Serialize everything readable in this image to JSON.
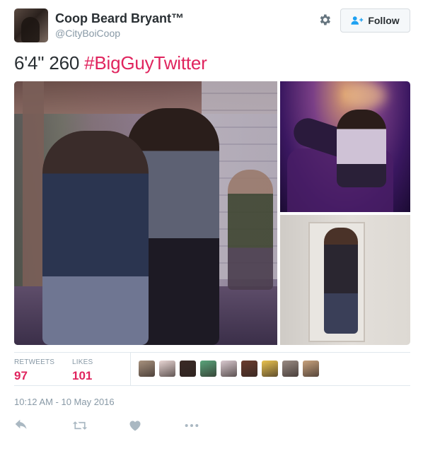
{
  "author": {
    "display_name": "Coop Beard Bryant™",
    "screen_name": "@CityBoiCoop"
  },
  "header": {
    "follow_label": "Follow"
  },
  "tweet": {
    "text": "6'4\" 260",
    "hashtag": "#BigGuyTwitter"
  },
  "stats": {
    "retweets_label": "RETWEETS",
    "retweets_count": "97",
    "likes_label": "LIKES",
    "likes_count": "101"
  },
  "likers": [
    {
      "color": "#a8927e"
    },
    {
      "color": "#e8d5d3"
    },
    {
      "color": "#3b2a25"
    },
    {
      "color": "#5aa57b"
    },
    {
      "color": "#d9c9cf"
    },
    {
      "color": "#6b3c2e"
    },
    {
      "color": "#e9c24f"
    },
    {
      "color": "#9a8b83"
    },
    {
      "color": "#c8a27d"
    }
  ],
  "timestamp": "10:12 AM - 10 May 2016",
  "colors": {
    "accent_red": "#e0245e",
    "muted": "#8899a6",
    "border": "#e1e8ed"
  }
}
